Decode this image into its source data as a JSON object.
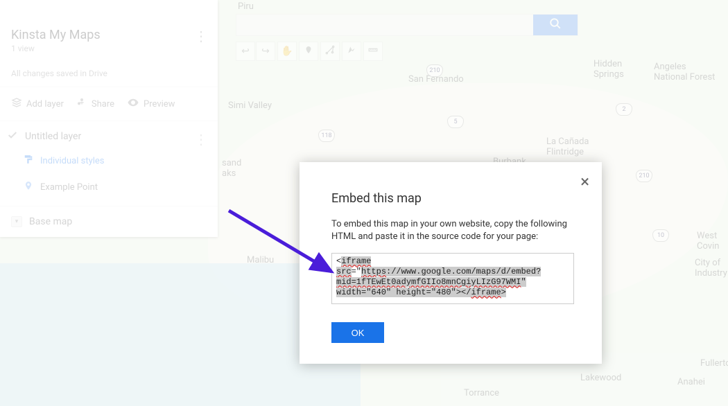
{
  "sidebar": {
    "title": "Kinsta My Maps",
    "views": "1 view",
    "saved_status": "All changes saved in Drive",
    "tools": {
      "add_layer": "Add layer",
      "share": "Share",
      "preview": "Preview"
    },
    "layer": {
      "title": "Untitled layer",
      "styles_label": "Individual styles",
      "point_label": "Example Point"
    },
    "basemap_label": "Base map"
  },
  "search": {
    "placeholder": ""
  },
  "toolbar": {
    "undo": "undo-icon",
    "redo": "redo-icon",
    "hand": "hand-icon",
    "marker": "marker-icon",
    "line": "line-icon",
    "route": "route-icon",
    "measure": "measure-icon"
  },
  "dialog": {
    "title": "Embed this map",
    "description": "To embed this map in your own website, copy the following HTML and paste it in the source code for your page:",
    "embed_tag_open": "iframe",
    "embed_attr_src": "src",
    "embed_proto": "https",
    "embed_host": "://www.google.com",
    "embed_path": "/maps/d/embed?",
    "embed_mid": "mid=1fTEwEt0adymfGIIo8mnCgiyLIzG97WMI",
    "embed_dims": "\" width=\"640\" height=\"480\"></",
    "embed_tag_close": "iframe",
    "ok_label": "OK"
  },
  "map_labels": {
    "piru": "Piru",
    "simi": "Simi Valley",
    "sand": "sand\naks",
    "sanfernando": "San Fernando",
    "lacanada": "La Cañada\nFlintridge",
    "burbank": "Burbank",
    "hidden": "Hidden\nSprings",
    "angeles": "Angeles\nNational Forest",
    "malibu": "Malibu",
    "westcovina": "West Covin",
    "cityof": "City of\nIndustry",
    "torrance": "Torrance",
    "lakewood": "Lakewood",
    "anaheim": "Anahei",
    "fullerton": "Fullerto"
  },
  "shields": {
    "s1": "210",
    "s2": "5",
    "s3": "210",
    "s4": "2",
    "s5": "118",
    "s6": "10"
  }
}
